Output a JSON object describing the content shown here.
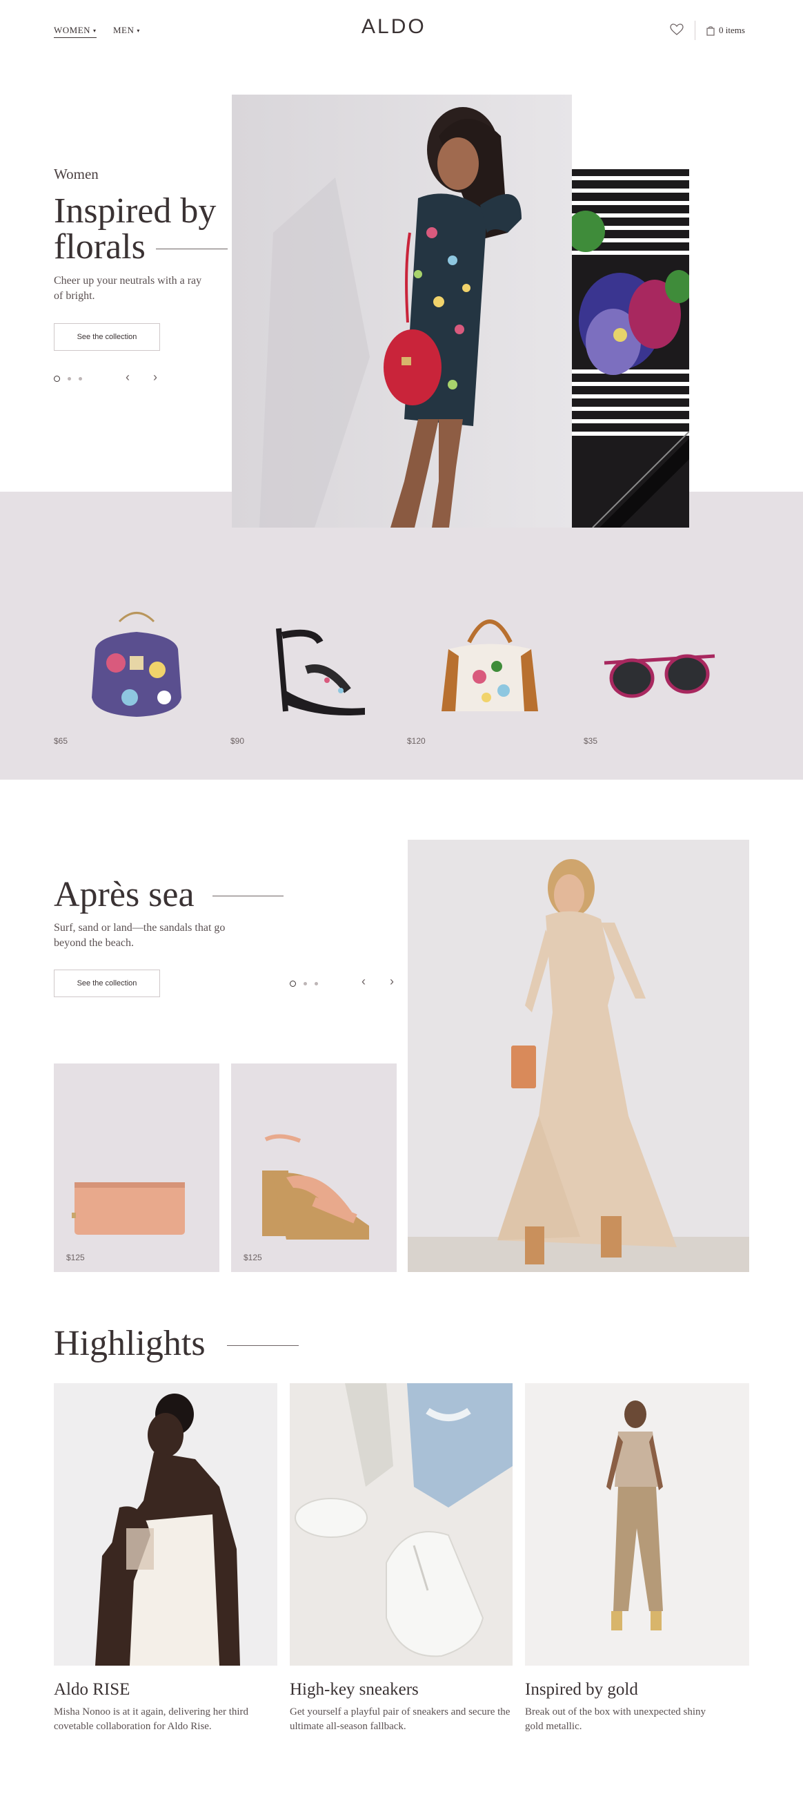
{
  "header": {
    "nav": [
      "WOMEN",
      "MEN"
    ],
    "logo": "ALDO",
    "cart_label": "0 items",
    "icons": [
      "heart-icon",
      "shopping-bag-icon"
    ]
  },
  "hero": {
    "eyebrow": "Women",
    "title_line1": "Inspired by",
    "title_line2": "florals",
    "subtitle": "Cheer up your neutrals with a ray of bright.",
    "cta": "See the collection",
    "carousel_total": 3,
    "carousel_active": 1
  },
  "floral_products": [
    {
      "name": "floral-handbag",
      "price": "$65"
    },
    {
      "name": "floral-sandal",
      "price": "$90"
    },
    {
      "name": "floral-satchel",
      "price": "$120"
    },
    {
      "name": "floral-sunglasses",
      "price": "$35"
    }
  ],
  "apres": {
    "title": "Après sea",
    "subtitle": "Surf, sand or land—the sandals that go beyond the beach.",
    "cta": "See the collection",
    "products": [
      {
        "name": "peach-wallet",
        "price": "$125"
      },
      {
        "name": "cork-sandal",
        "price": "$125"
      }
    ]
  },
  "highlights": {
    "title": "Highlights",
    "cards": [
      {
        "title": "Aldo RISE",
        "desc": "Misha Nonoo is at it again, delivering her third covetable collaboration for Aldo Rise."
      },
      {
        "title": "High-key sneakers",
        "desc": "Get yourself a playful pair of sneakers and secure the ultimate all-season fallback."
      },
      {
        "title": "Inspired by gold",
        "desc": "Break out of the box with unexpected shiny gold metallic."
      }
    ]
  },
  "colors": {
    "background": "#ffffff",
    "band": "#e5e0e4",
    "text": "#3a3233",
    "card_bg": "#e5e0e4"
  }
}
